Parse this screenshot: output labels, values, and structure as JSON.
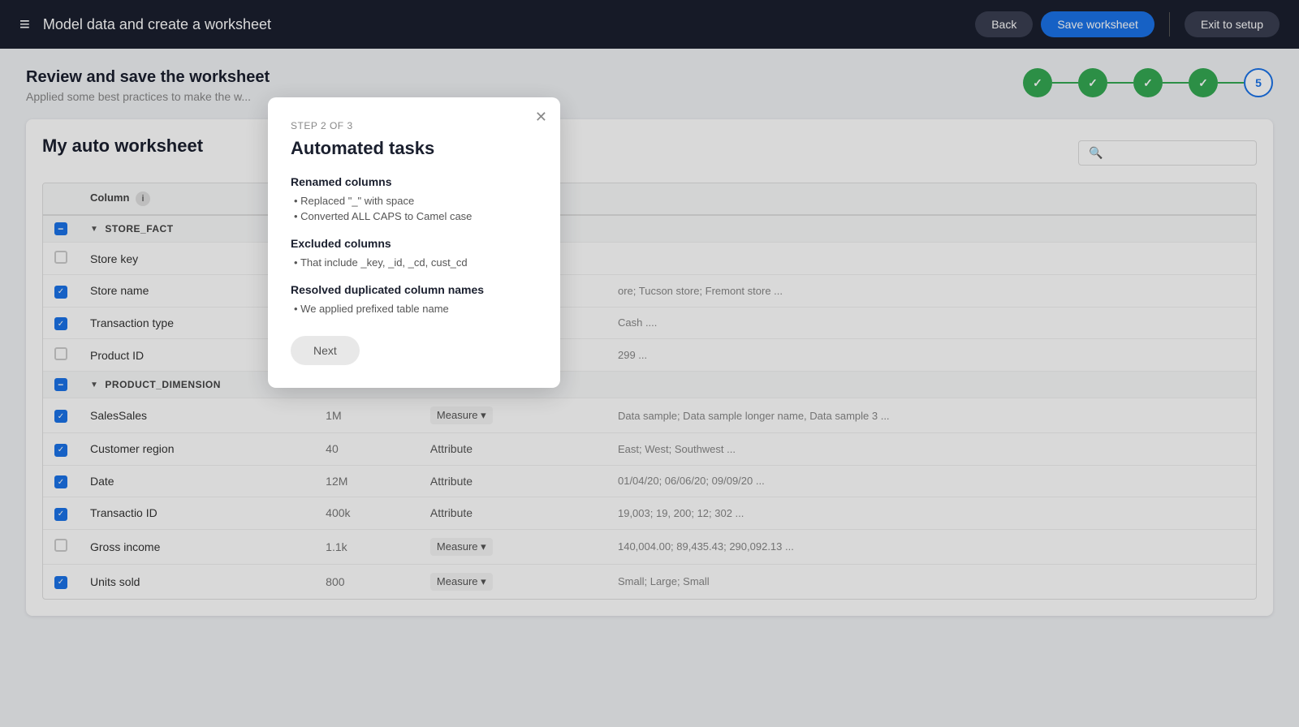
{
  "header": {
    "logo": "≡",
    "title": "Model data and create a worksheet",
    "back_label": "Back",
    "save_label": "Save worksheet",
    "exit_label": "Exit to setup"
  },
  "page": {
    "title": "Review and save the worksheet",
    "subtitle": "Applied some best practices to make the w..."
  },
  "steps": [
    {
      "id": 1,
      "status": "completed",
      "label": "✓"
    },
    {
      "id": 2,
      "status": "completed",
      "label": "✓"
    },
    {
      "id": 3,
      "status": "completed",
      "label": "✓"
    },
    {
      "id": 4,
      "status": "completed",
      "label": "✓"
    },
    {
      "id": 5,
      "status": "current",
      "label": "5"
    }
  ],
  "worksheet": {
    "name": "My auto worksheet",
    "search_placeholder": ""
  },
  "table": {
    "columns": [
      "Column",
      "",
      ""
    ],
    "groups": [
      {
        "name": "STORE_FACT",
        "rows": [
          {
            "checked": false,
            "name": "Store key",
            "count": "",
            "type": "",
            "samples": ""
          },
          {
            "checked": true,
            "name": "Store name",
            "count": "",
            "type": "",
            "samples": "ore; Tucson store; Fremont store ..."
          },
          {
            "checked": true,
            "name": "Transaction type",
            "count": "",
            "type": "",
            "samples": "Cash ...."
          },
          {
            "checked": false,
            "name": "Product ID",
            "count": "",
            "type": "",
            "samples": "299 ..."
          }
        ]
      },
      {
        "name": "PRODUCT_DIMENSION",
        "rows": [
          {
            "checked": true,
            "name": "SalesSales",
            "count": "1M",
            "type": "Measure",
            "has_dropdown": true,
            "samples": "Data sample; Data sample longer name, Data sample 3 ..."
          },
          {
            "checked": true,
            "name": "Customer region",
            "count": "40",
            "type": "Attribute",
            "has_dropdown": false,
            "samples": "East; West; Southwest ..."
          },
          {
            "checked": true,
            "name": "Date",
            "count": "12M",
            "type": "Attribute",
            "has_dropdown": false,
            "samples": "01/04/20; 06/06/20; 09/09/20 ..."
          },
          {
            "checked": true,
            "name": "Transactio ID",
            "count": "400k",
            "type": "Attribute",
            "has_dropdown": false,
            "samples": "19,003; 19, 200; 12; 302 ..."
          },
          {
            "checked": false,
            "name": "Gross income",
            "count": "1.1k",
            "type": "Measure",
            "has_dropdown": true,
            "samples": "140,004.00; 89,435.43; 290,092.13 ..."
          },
          {
            "checked": true,
            "name": "Units sold",
            "count": "800",
            "type": "Measure",
            "has_dropdown": true,
            "samples": "Small; Large; Small"
          }
        ]
      }
    ]
  },
  "modal": {
    "step": "STEP 2 OF 3",
    "title": "Automated tasks",
    "sections": [
      {
        "title": "Renamed columns",
        "bullets": [
          "Replaced \"_\" with space",
          "Converted ALL CAPS to Camel case"
        ]
      },
      {
        "title": "Excluded columns",
        "bullets": [
          "That include _key, _id, _cd, cust_cd"
        ]
      },
      {
        "title": "Resolved duplicated column names",
        "bullets": [
          "We applied prefixed table name"
        ]
      }
    ],
    "next_label": "Next"
  }
}
